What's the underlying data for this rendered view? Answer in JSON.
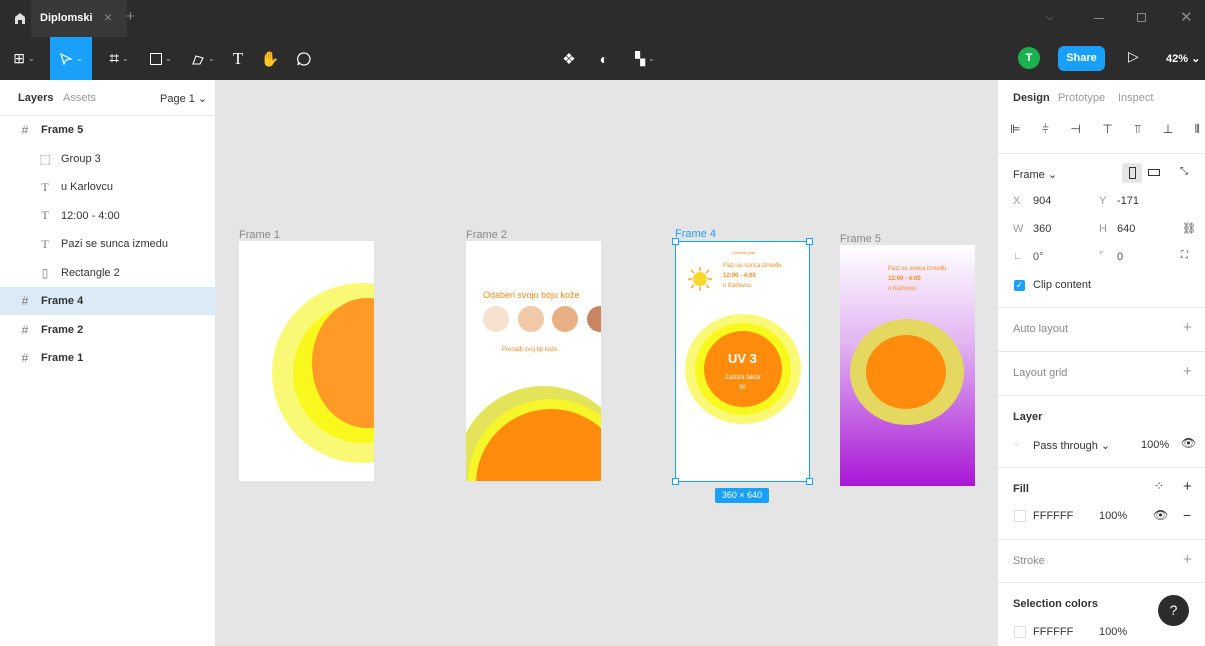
{
  "title": {
    "tab_name": "Diplomski",
    "close": "×",
    "plus": "+"
  },
  "toolbar": {
    "text_tool": "T",
    "share": "Share",
    "zoom": "42% ⌄",
    "avatar": "T",
    "play": "▷"
  },
  "layers_panel": {
    "tab_layers": "Layers",
    "tab_assets": "Assets",
    "page": "Page 1 ⌄",
    "items": [
      {
        "name": "Frame 5",
        "icon": "#",
        "level": 0,
        "bold": true
      },
      {
        "name": "Group 3",
        "icon": "⬚",
        "level": 1
      },
      {
        "name": "u Karlovcu",
        "icon": "T",
        "level": 1
      },
      {
        "name": "12:00 - 4:00",
        "icon": "T",
        "level": 1
      },
      {
        "name": "Pazi se sunca izmedu",
        "icon": "T",
        "level": 1
      },
      {
        "name": "Rectangle 2",
        "icon": "▯",
        "level": 1
      },
      {
        "name": "Frame 4",
        "icon": "#",
        "level": 0,
        "bold": true,
        "selected": true
      },
      {
        "name": "Frame 2",
        "icon": "#",
        "level": 0,
        "bold": true
      },
      {
        "name": "Frame 1",
        "icon": "#",
        "level": 0,
        "bold": true
      }
    ]
  },
  "canvas": {
    "frame1_label": "Frame 1",
    "frame2_label": "Frame 2",
    "frame4_label": "Frame 4",
    "frame5_label": "Frame 5",
    "frame2_title": "Odaberi svoju boju kože",
    "frame2_link": "Pronađi svoj tip kože",
    "frame4_top": "Odaberi grad",
    "frame4_line1": "Pazi se sunca između",
    "frame4_line2": "12:00 - 4:00",
    "frame4_line3": "u Karlovcu",
    "frame4_uv": "UV 3",
    "frame4_factor1": "Zaštitni faktor",
    "frame4_factor2": "30",
    "frame5_line1": "Pazi se sunca između",
    "frame5_line2": "12:00 - 4:00",
    "frame5_line3": "u Karlovcu",
    "size_badge": "360 × 640"
  },
  "design_panel": {
    "tab_design": "Design",
    "tab_prototype": "Prototype",
    "tab_inspect": "Inspect",
    "frame_label": "Frame ⌄",
    "x_label": "X",
    "x_value": "904",
    "y_label": "Y",
    "y_value": "-171",
    "w_label": "W",
    "w_value": "360",
    "h_label": "H",
    "h_value": "640",
    "rotation": "0°",
    "radius": "0",
    "clip_content": "Clip content",
    "auto_layout": "Auto layout",
    "layout_grid": "Layout grid",
    "layer": "Layer",
    "blend": "Pass through ⌄",
    "opacity": "100%",
    "fill": "Fill",
    "fill_hex": "FFFFFF",
    "fill_opacity": "100%",
    "stroke": "Stroke",
    "selection_colors": "Selection colors",
    "sel_hex": "FFFFFF",
    "sel_opacity": "100%",
    "help": "?"
  },
  "colors": {
    "accent": "#18a0fb",
    "selected_row": "#daebf7",
    "orange": "#ff8c0d",
    "yellow": "#f9f93d"
  }
}
